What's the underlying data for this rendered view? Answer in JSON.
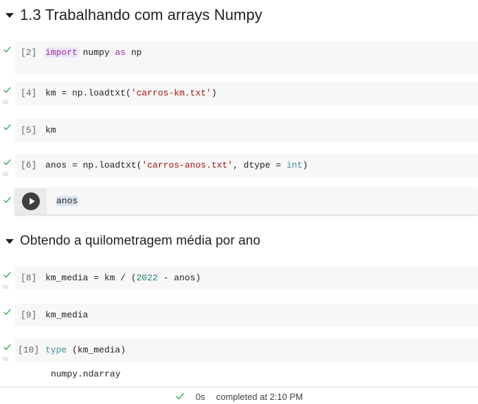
{
  "sections": [
    {
      "title": "1.3 Trabalhando com arrays Numpy",
      "toggle_icon": "triangle-down-icon"
    },
    {
      "title": "Obtendo a quilometragem média por ano",
      "toggle_icon": "triangle-down-icon"
    }
  ],
  "cells": [
    {
      "index": "[2]",
      "status_icon": "check-icon",
      "timing": "",
      "tokens": [
        {
          "t": "import",
          "c": "kw-hl"
        },
        {
          "t": " numpy ",
          "c": "plain"
        },
        {
          "t": "as",
          "c": "kw"
        },
        {
          "t": " np",
          "c": "plain"
        }
      ]
    },
    {
      "index": "[4]",
      "status_icon": "check-icon",
      "timing": "0s",
      "tokens": [
        {
          "t": "km = np.loadtxt(",
          "c": "plain"
        },
        {
          "t": "'carros-km.txt'",
          "c": "str"
        },
        {
          "t": ")",
          "c": "plain"
        }
      ]
    },
    {
      "index": "[5]",
      "status_icon": "check-icon",
      "timing": "",
      "tokens": [
        {
          "t": "km",
          "c": "plain"
        }
      ]
    },
    {
      "index": "[6]",
      "status_icon": "check-icon",
      "timing": "0s",
      "tokens": [
        {
          "t": "anos = np.loadtxt(",
          "c": "plain"
        },
        {
          "t": "'carros-anos.txt'",
          "c": "str"
        },
        {
          "t": ", dtype = ",
          "c": "plain"
        },
        {
          "t": "int",
          "c": "builtin"
        },
        {
          "t": ")",
          "c": "plain"
        }
      ]
    }
  ],
  "active_cell": {
    "status_icon": "check-icon",
    "run_icon": "play-icon",
    "code_selected": "anos"
  },
  "cells2": [
    {
      "index": "[8]",
      "status_icon": "check-icon",
      "timing": "0s",
      "tokens": [
        {
          "t": "km_media = km / (",
          "c": "plain"
        },
        {
          "t": "2022",
          "c": "num"
        },
        {
          "t": " - anos)",
          "c": "plain"
        }
      ]
    },
    {
      "index": "[9]",
      "status_icon": "check-icon",
      "timing": "",
      "tokens": [
        {
          "t": "km_media",
          "c": "plain"
        }
      ]
    },
    {
      "index": "[10]",
      "status_icon": "check-icon",
      "timing": "0s",
      "tokens": [
        {
          "t": "type",
          "c": "builtin"
        },
        {
          "t": " (km_media)",
          "c": "plain"
        }
      ]
    }
  ],
  "output": {
    "text": "numpy.ndarray"
  },
  "status_bar": {
    "status_icon": "check-icon",
    "elapsed": "0s",
    "message": "completed at 2:10 PM"
  },
  "colors": {
    "cell_background": "#f7f7f7",
    "page_background": "#ffffff",
    "keyword": "#a626a4",
    "string": "#a31515",
    "builtin": "#3f8c9e",
    "number": "#1a7f6e",
    "text": "#202124",
    "check_green": "#34a853",
    "run_button": "#3c4043",
    "selection": "#dce4ef"
  }
}
